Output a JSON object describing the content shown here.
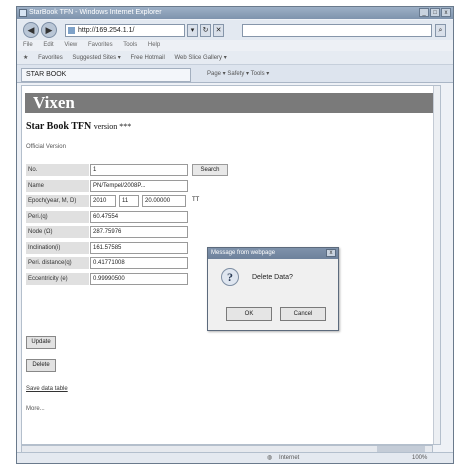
{
  "window": {
    "title": "StarBook TFN - Windows Internet Explorer",
    "controls": [
      "_",
      "□",
      "x"
    ]
  },
  "address": {
    "url": "http://169.254.1.1/",
    "nav_back": "◀",
    "nav_forward": "▶"
  },
  "menu": [
    "File",
    "Edit",
    "View",
    "Favorites",
    "Tools",
    "Help"
  ],
  "favorites": {
    "label": "Favorites",
    "items": [
      "Suggested Sites ▾",
      "Free Hotmail",
      "Web Slice Gallery ▾"
    ]
  },
  "tab": {
    "label": "STAR BOOK"
  },
  "commandbar": {
    "text": "Page ▾  Safety ▾  Tools ▾"
  },
  "page": {
    "banner": "Vixen",
    "heading": "Star Book TFN",
    "heading_version": "version ***",
    "official": "Official Version",
    "form": {
      "rows": [
        {
          "label": "No.",
          "value": "1",
          "button": "Search"
        },
        {
          "label": "Name",
          "value": "PN/Tempel/2008P..."
        },
        {
          "label": "Epoch(year, M, D)",
          "cells": [
            "2010",
            "11",
            "20.00000",
            "TT"
          ]
        },
        {
          "label": "Peri.(q)",
          "value": "60.47554"
        },
        {
          "label": "Node (Ω)",
          "value": "287.75976"
        },
        {
          "label": "Inclination(i)",
          "value": "161.57585"
        },
        {
          "label": "Peri. distance(q)",
          "value": "0.41771008"
        },
        {
          "label": "Eccentricity (e)",
          "value": "0.99990500"
        }
      ]
    },
    "button_update": "Update",
    "button_delete": "Delete",
    "link_text": "Save data table",
    "more": "More..."
  },
  "dialog": {
    "title": "Message from webpage",
    "close": "x",
    "message": "Delete Data?",
    "ok": "OK",
    "cancel": "Cancel"
  },
  "statusbar": {
    "zone": "Internet",
    "zoom": "100%"
  }
}
